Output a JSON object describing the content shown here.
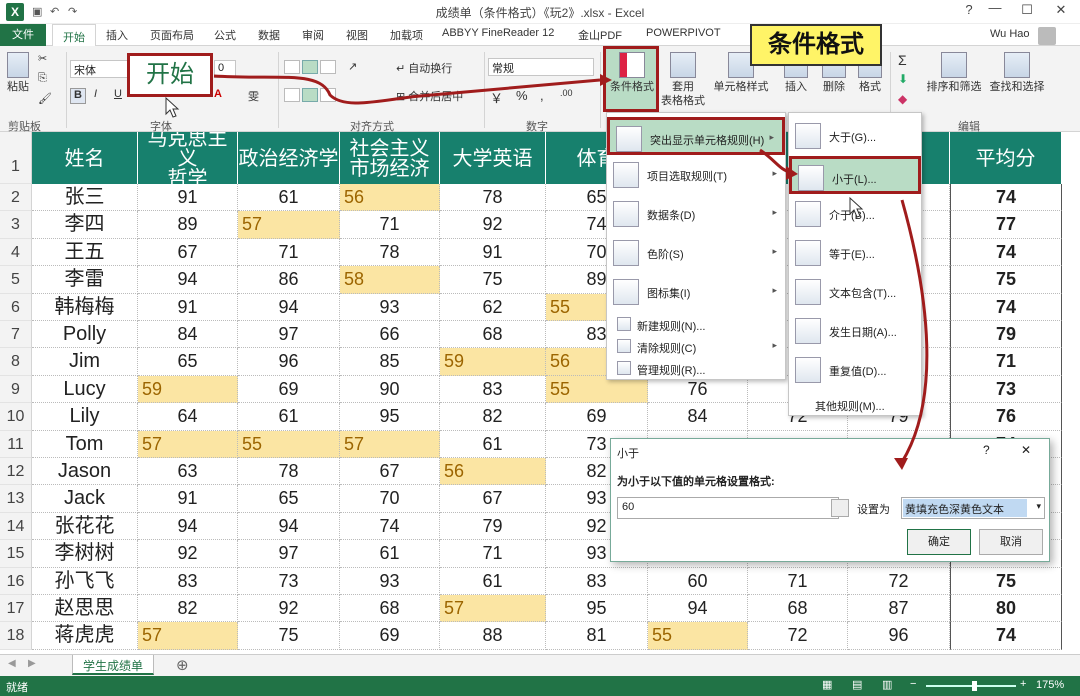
{
  "window": {
    "title": "成绩单（条件格式）《玩2》.xlsx - Excel",
    "help": "?",
    "minimize": "—",
    "maximize": "☐",
    "close": "✕"
  },
  "tabs": {
    "file": "文件",
    "home": "开始",
    "items": [
      "插入",
      "页面布局",
      "公式",
      "数据",
      "审阅",
      "视图",
      "加载项",
      "ABBYY FineReader 12",
      "金山PDF",
      "POWERPIVOT"
    ],
    "user": "Wu Hao"
  },
  "ribbon": {
    "paste": "粘贴",
    "font_name": "宋体",
    "font_size": "0",
    "wrap": "自动换行",
    "merge": "合并后居中",
    "number_format": "常规",
    "cond_format": "条件格式",
    "table_format_1": "套用",
    "table_format_2": "表格格式",
    "cell_style": "单元格样式",
    "insert": "插入",
    "delete": "删除",
    "format": "格式",
    "sort": "排序和筛选",
    "find": "查找和选择",
    "groups": {
      "clipboard": "剪贴板",
      "font": "字体",
      "alignment": "对齐方式",
      "number": "数字",
      "editing": "编辑"
    }
  },
  "callouts": {
    "start": "开始",
    "cond_format": "条件格式"
  },
  "sheet": {
    "row_numbers": [
      "1",
      "2",
      "3",
      "4",
      "5",
      "6",
      "7",
      "8",
      "9",
      "10",
      "11",
      "12",
      "13",
      "14",
      "15",
      "16",
      "17",
      "18"
    ],
    "headers": [
      "姓名",
      "马克思主义\n哲学",
      "政治经济学",
      "社会主义\n市场经济",
      "大学英语",
      "体育",
      "",
      "",
      "",
      "平均分"
    ],
    "rows": [
      {
        "name": "张三",
        "c": [
          "91",
          "61",
          "56",
          "78",
          "65",
          "",
          "",
          "",
          ""
        ],
        "avg": "74"
      },
      {
        "name": "李四",
        "c": [
          "89",
          "57",
          "71",
          "92",
          "74",
          "",
          "",
          "",
          ""
        ],
        "avg": "77"
      },
      {
        "name": "王五",
        "c": [
          "67",
          "71",
          "78",
          "91",
          "70",
          "",
          "",
          "",
          ""
        ],
        "avg": "74"
      },
      {
        "name": "李雷",
        "c": [
          "94",
          "86",
          "58",
          "75",
          "89",
          "",
          "",
          "",
          ""
        ],
        "avg": "75"
      },
      {
        "name": "韩梅梅",
        "c": [
          "91",
          "94",
          "93",
          "62",
          "55",
          "",
          "",
          "",
          ""
        ],
        "avg": "74"
      },
      {
        "name": "Polly",
        "c": [
          "84",
          "97",
          "66",
          "68",
          "83",
          "",
          "",
          "",
          ""
        ],
        "avg": "79"
      },
      {
        "name": "Jim",
        "c": [
          "65",
          "96",
          "85",
          "59",
          "56",
          "",
          "",
          "",
          ""
        ],
        "avg": "71"
      },
      {
        "name": "Lucy",
        "c": [
          "59",
          "69",
          "90",
          "83",
          "55",
          "76",
          "",
          "",
          ""
        ],
        "avg": "73"
      },
      {
        "name": "Lily",
        "c": [
          "64",
          "61",
          "95",
          "82",
          "69",
          "84",
          "72",
          "79",
          ""
        ],
        "avg": "76"
      },
      {
        "name": "Tom",
        "c": [
          "57",
          "55",
          "57",
          "61",
          "73",
          "",
          "",
          "",
          ""
        ],
        "avg": "74"
      },
      {
        "name": "Jason",
        "c": [
          "63",
          "78",
          "67",
          "56",
          "82",
          "",
          "",
          "",
          ""
        ],
        "avg": "72"
      },
      {
        "name": "Jack",
        "c": [
          "91",
          "65",
          "70",
          "67",
          "93",
          "",
          "",
          "",
          ""
        ],
        "avg": "74"
      },
      {
        "name": "张花花",
        "c": [
          "94",
          "94",
          "74",
          "79",
          "92",
          "",
          "",
          "",
          ""
        ],
        "avg": "73"
      },
      {
        "name": "李树树",
        "c": [
          "92",
          "97",
          "61",
          "71",
          "93",
          "",
          "",
          "",
          ""
        ],
        "avg": "75"
      },
      {
        "name": "孙飞飞",
        "c": [
          "83",
          "73",
          "93",
          "61",
          "83",
          "60",
          "71",
          "72",
          ""
        ],
        "avg": "75"
      },
      {
        "name": "赵思思",
        "c": [
          "82",
          "92",
          "68",
          "57",
          "95",
          "94",
          "68",
          "87",
          ""
        ],
        "avg": "80"
      },
      {
        "name": "蒋虎虎",
        "c": [
          "57",
          "75",
          "69",
          "88",
          "81",
          "55",
          "72",
          "96",
          ""
        ],
        "avg": "74"
      }
    ]
  },
  "cf_menu": {
    "items": [
      {
        "label": "突出显示单元格规则(H)",
        "arrow": "▸"
      },
      {
        "label": "项目选取规则(T)",
        "arrow": "▸"
      },
      {
        "label": "数据条(D)",
        "arrow": "▸"
      },
      {
        "label": "色阶(S)",
        "arrow": "▸"
      },
      {
        "label": "图标集(I)",
        "arrow": "▸"
      }
    ],
    "small": [
      {
        "label": "新建规则(N)...",
        "arrow": ""
      },
      {
        "label": "清除规则(C)",
        "arrow": "▸"
      },
      {
        "label": "管理规则(R)...",
        "arrow": ""
      }
    ]
  },
  "sub_menu": {
    "items": [
      "大于(G)...",
      "小于(L)...",
      "介于(B)...",
      "等于(E)...",
      "文本包含(T)...",
      "发生日期(A)...",
      "重复值(D)..."
    ],
    "more": "其他规则(M)..."
  },
  "dialog": {
    "title": "小于",
    "help": "?",
    "close": "✕",
    "prompt": "为小于以下值的单元格设置格式:",
    "value": "60",
    "set_as": "设置为",
    "format": "黄填充色深黄色文本",
    "ok": "确定",
    "cancel": "取消"
  },
  "sheet_tab": "学生成绩单",
  "add_sheet": "⊕",
  "status": {
    "ready": "就绪",
    "zoom": "175%",
    "minus": "−",
    "plus": "+"
  },
  "colors": {
    "excel_green": "#217346",
    "header_teal": "#17806d",
    "highlight_fill": "#fbe5a3",
    "highlight_text": "#9c6500",
    "callout_yellow": "#fff467",
    "red_frame": "#a01c1c"
  }
}
